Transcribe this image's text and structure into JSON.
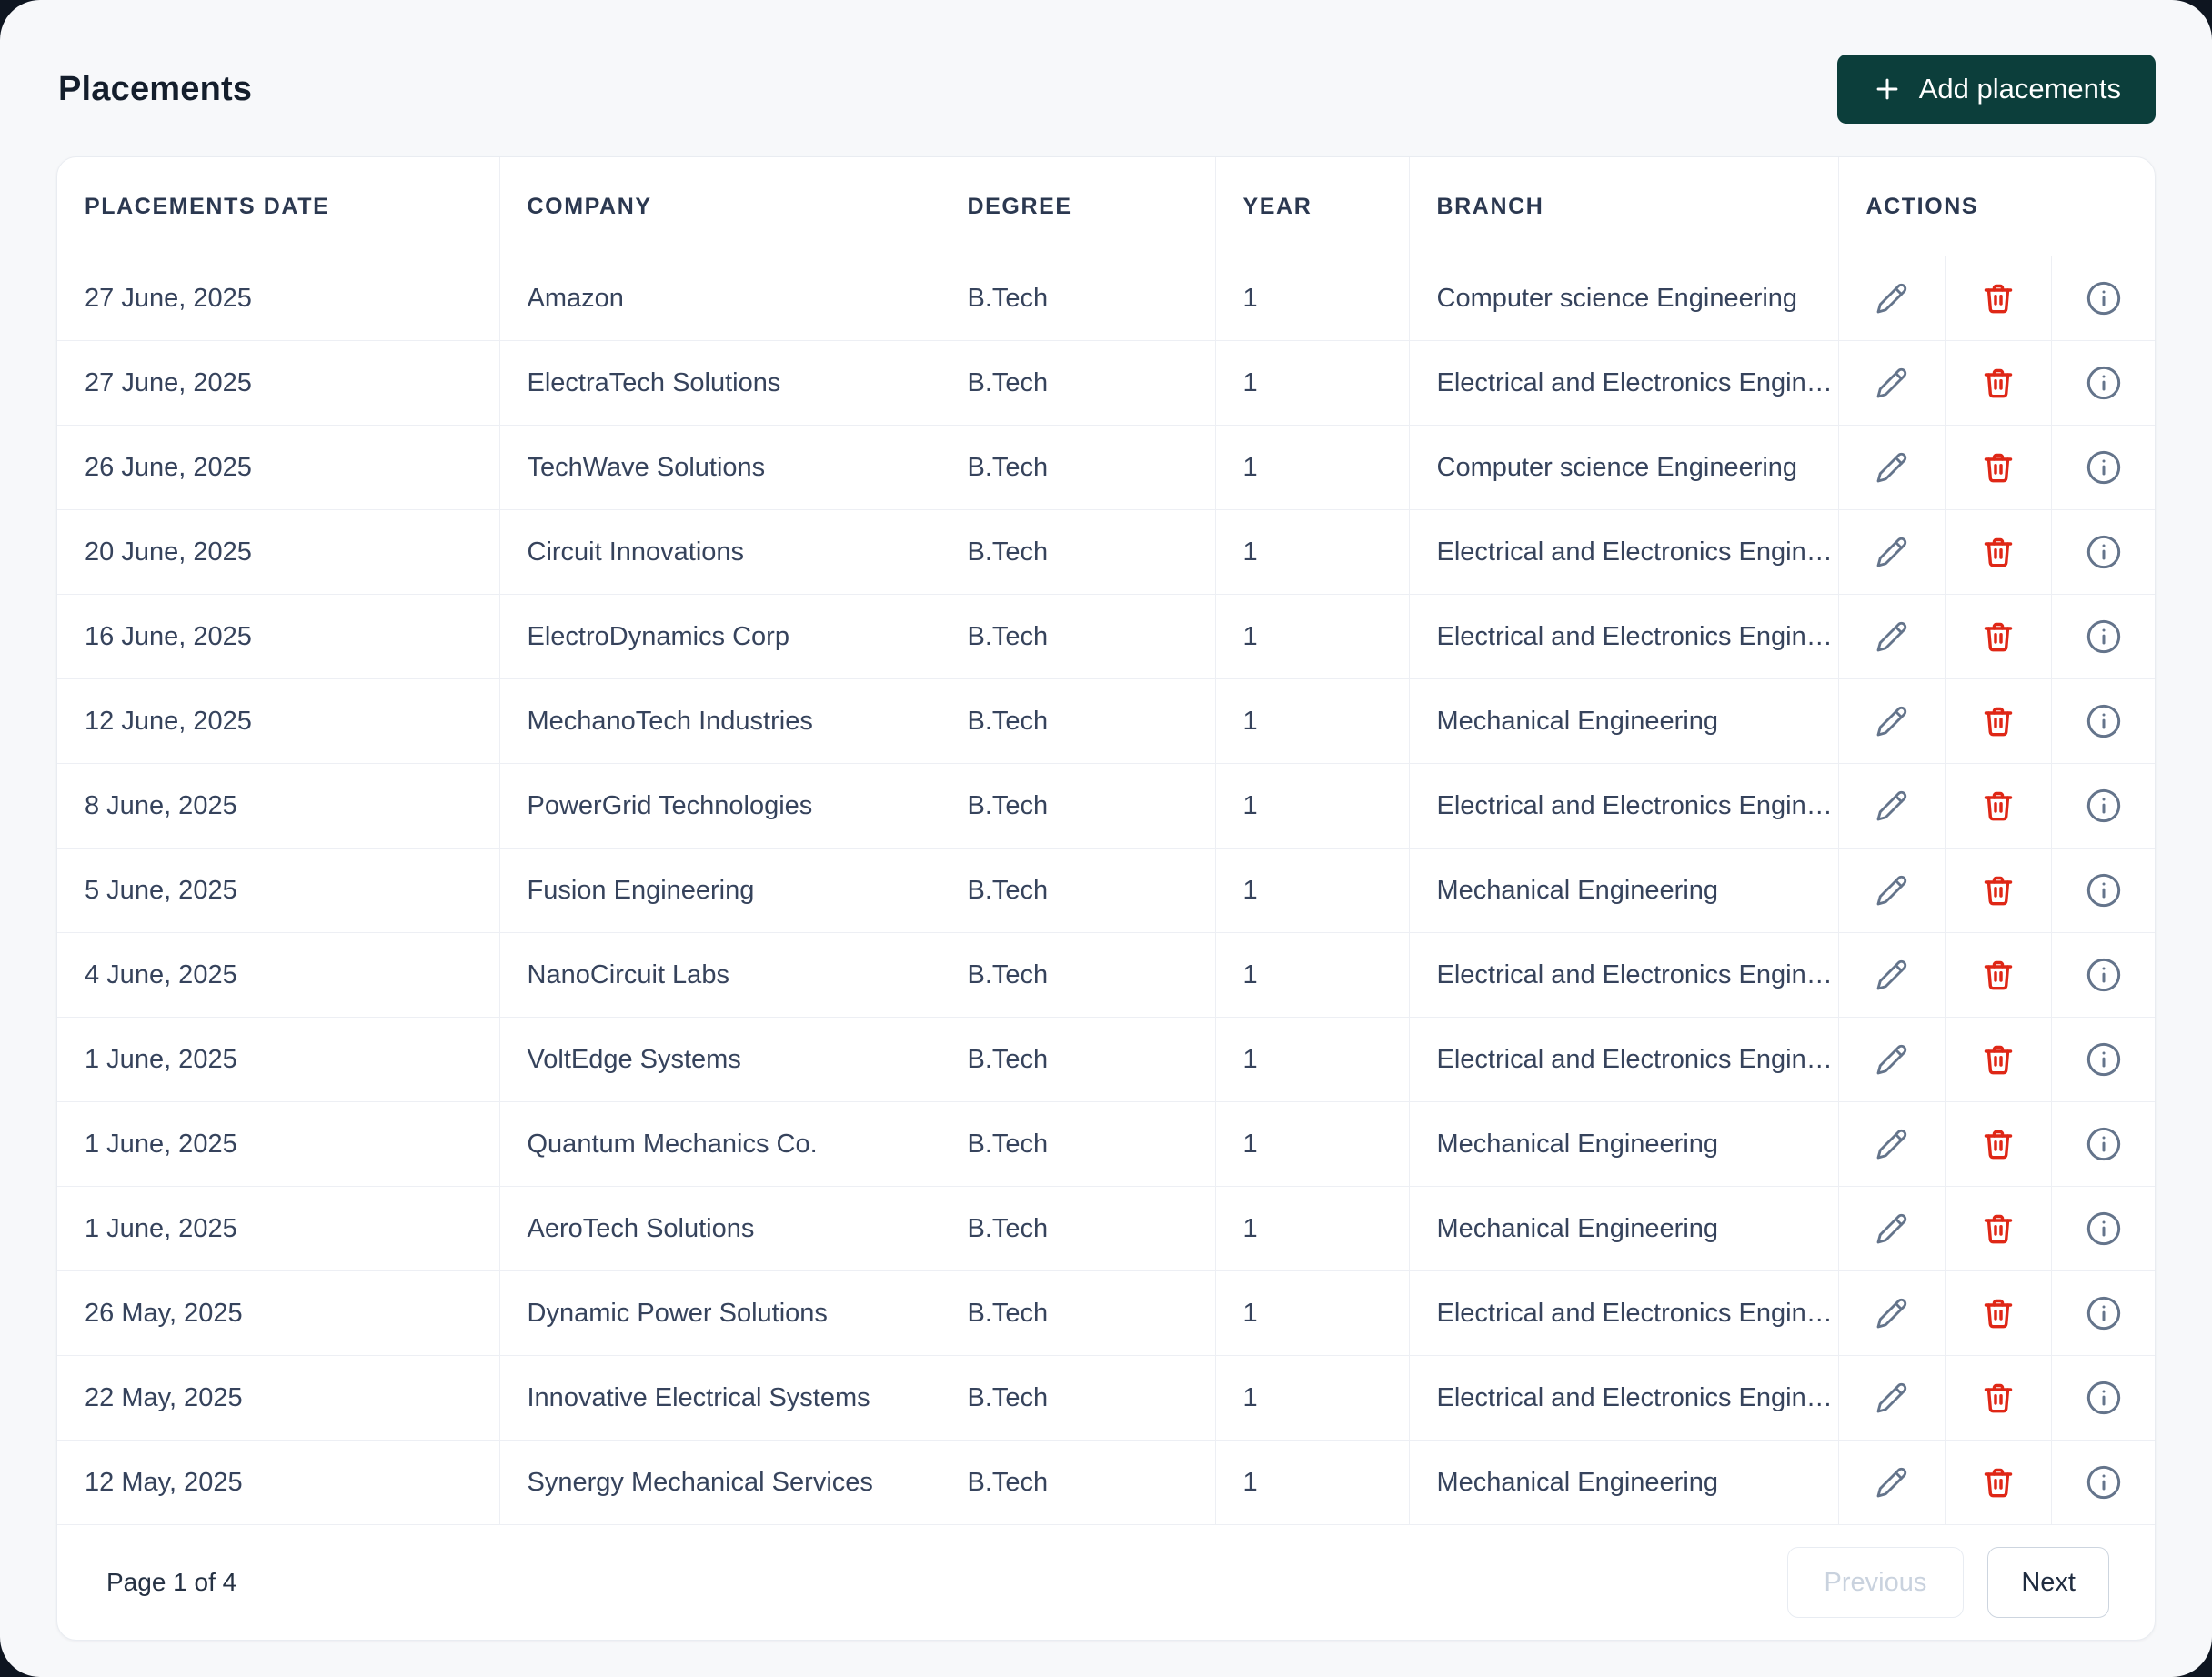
{
  "page": {
    "title": "Placements"
  },
  "toolbar": {
    "add_button_label": "Add placements",
    "add_button_icon": "plus-icon"
  },
  "table": {
    "columns": [
      "PLACEMENTS DATE",
      "COMPANY",
      "DEGREE",
      "YEAR",
      "BRANCH",
      "ACTIONS"
    ],
    "action_icons": [
      "edit-pencil-icon",
      "delete-trash-icon",
      "info-icon"
    ],
    "rows": [
      {
        "date": "27 June, 2025",
        "company": "Amazon",
        "degree": "B.Tech",
        "year": "1",
        "branch": "Computer science Engineering"
      },
      {
        "date": "27 June, 2025",
        "company": "ElectraTech Solutions",
        "degree": "B.Tech",
        "year": "1",
        "branch": "Electrical and Electronics Enginee..."
      },
      {
        "date": "26 June, 2025",
        "company": "TechWave Solutions",
        "degree": "B.Tech",
        "year": "1",
        "branch": "Computer science Engineering"
      },
      {
        "date": "20 June, 2025",
        "company": "Circuit Innovations",
        "degree": "B.Tech",
        "year": "1",
        "branch": "Electrical and Electronics Enginee..."
      },
      {
        "date": "16 June, 2025",
        "company": "ElectroDynamics Corp",
        "degree": "B.Tech",
        "year": "1",
        "branch": "Electrical and Electronics Enginee..."
      },
      {
        "date": "12 June, 2025",
        "company": "MechanoTech Industries",
        "degree": "B.Tech",
        "year": "1",
        "branch": "Mechanical Engineering"
      },
      {
        "date": "8 June, 2025",
        "company": "PowerGrid Technologies",
        "degree": "B.Tech",
        "year": "1",
        "branch": "Electrical and Electronics Enginee..."
      },
      {
        "date": "5 June, 2025",
        "company": "Fusion Engineering",
        "degree": "B.Tech",
        "year": "1",
        "branch": "Mechanical Engineering"
      },
      {
        "date": "4 June, 2025",
        "company": "NanoCircuit Labs",
        "degree": "B.Tech",
        "year": "1",
        "branch": "Electrical and Electronics Enginee..."
      },
      {
        "date": "1 June, 2025",
        "company": "VoltEdge Systems",
        "degree": "B.Tech",
        "year": "1",
        "branch": "Electrical and Electronics Enginee..."
      },
      {
        "date": "1 June, 2025",
        "company": "Quantum Mechanics Co.",
        "degree": "B.Tech",
        "year": "1",
        "branch": "Mechanical Engineering"
      },
      {
        "date": "1 June, 2025",
        "company": "AeroTech Solutions",
        "degree": "B.Tech",
        "year": "1",
        "branch": "Mechanical Engineering"
      },
      {
        "date": "26 May, 2025",
        "company": "Dynamic Power Solutions",
        "degree": "B.Tech",
        "year": "1",
        "branch": "Electrical and Electronics Enginee..."
      },
      {
        "date": "22 May, 2025",
        "company": "Innovative Electrical Systems",
        "degree": "B.Tech",
        "year": "1",
        "branch": "Electrical and Electronics Enginee..."
      },
      {
        "date": "12 May, 2025",
        "company": "Synergy Mechanical Services",
        "degree": "B.Tech",
        "year": "1",
        "branch": "Mechanical Engineering"
      }
    ]
  },
  "pagination": {
    "status": "Page 1 of 4",
    "previous_label": "Previous",
    "next_label": "Next",
    "previous_disabled": true
  },
  "colors": {
    "accent_teal": "#0c3e3b",
    "danger_red": "#df2716",
    "icon_gray": "#64748b",
    "header_text": "#2b3850",
    "body_text": "#36435c"
  }
}
